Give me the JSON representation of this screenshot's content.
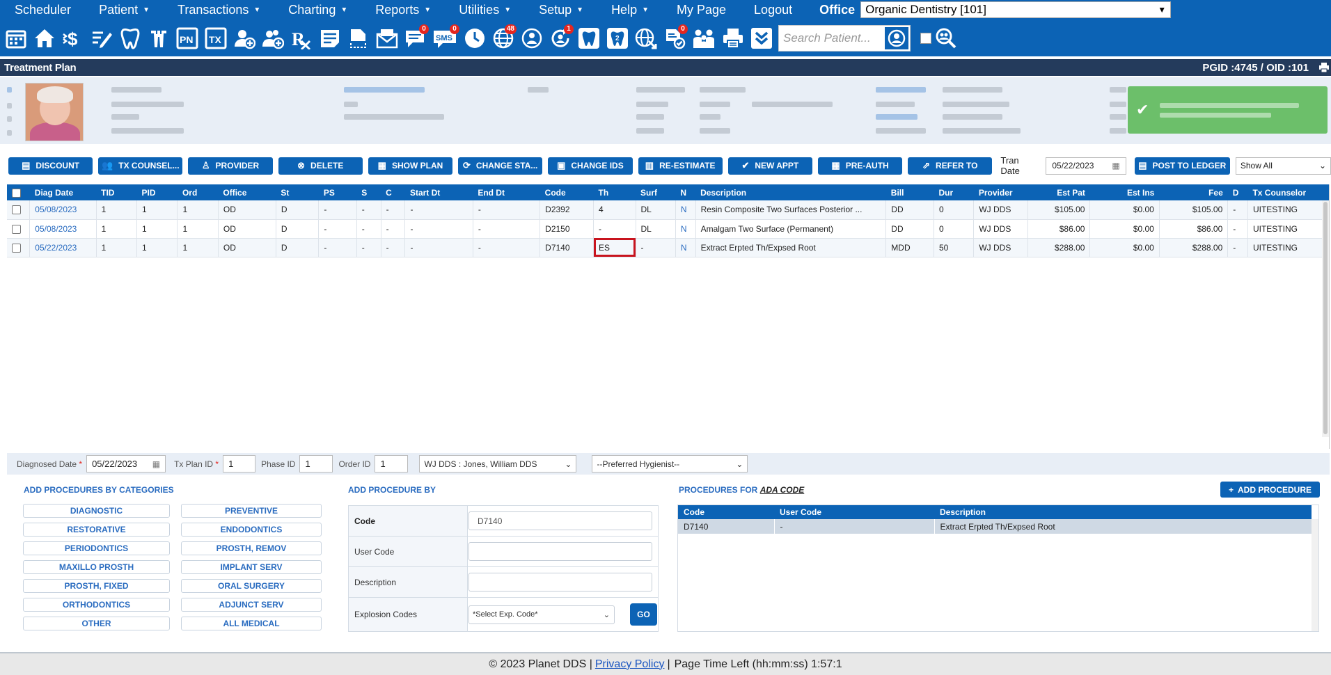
{
  "menu": {
    "items": [
      {
        "label": "Scheduler",
        "caret": false
      },
      {
        "label": "Patient",
        "caret": true
      },
      {
        "label": "Transactions",
        "caret": true
      },
      {
        "label": "Charting",
        "caret": true
      },
      {
        "label": "Reports",
        "caret": true
      },
      {
        "label": "Utilities",
        "caret": true
      },
      {
        "label": "Setup",
        "caret": true
      },
      {
        "label": "Help",
        "caret": true
      },
      {
        "label": "My Page",
        "caret": false
      },
      {
        "label": "Logout",
        "caret": false
      }
    ],
    "office_label": "Office",
    "office_value": "Organic Dentistry [101]"
  },
  "toolbar": {
    "badges": {
      "messages": "0",
      "sms": "0",
      "web": "48",
      "recall": "1",
      "docs": "0"
    },
    "sms_label": "SMS",
    "pn_label": "PN",
    "tx_label": "TX",
    "search_placeholder": "Search Patient..."
  },
  "titlebar": {
    "title": "Treatment Plan",
    "ids": "PGID :4745  /  OID :101"
  },
  "actions": {
    "buttons": [
      {
        "label": "DISCOUNT",
        "icon": "doc-icon"
      },
      {
        "label": "TX COUNSEL...",
        "icon": "people-icon"
      },
      {
        "label": "PROVIDER",
        "icon": "user-icon"
      },
      {
        "label": "DELETE",
        "icon": "close-circle-icon"
      },
      {
        "label": "SHOW PLAN",
        "icon": "calendar-icon"
      },
      {
        "label": "CHANGE STA...",
        "icon": "refresh-icon"
      },
      {
        "label": "CHANGE IDS",
        "icon": "id-card-icon"
      },
      {
        "label": "RE-ESTIMATE",
        "icon": "calculator-icon"
      },
      {
        "label": "NEW APPT",
        "icon": "check-circle-icon"
      },
      {
        "label": "PRE-AUTH",
        "icon": "calendar-check-icon"
      },
      {
        "label": "REFER TO",
        "icon": "refer-icon"
      }
    ],
    "tran_date_label": "Tran Date",
    "tran_date": "05/22/2023",
    "post_label": "POST TO LEDGER",
    "show_all": "Show All"
  },
  "table": {
    "headers": [
      "Diag Date",
      "TID",
      "PID",
      "Ord",
      "Office",
      "St",
      "PS",
      "S",
      "C",
      "Start Dt",
      "End Dt",
      "Code",
      "Th",
      "Surf",
      "N",
      "Description",
      "Bill",
      "Dur",
      "Provider",
      "Est Pat",
      "Est Ins",
      "Fee",
      "D",
      "Tx Counselor"
    ],
    "rows": [
      [
        "05/08/2023",
        "1",
        "1",
        "1",
        "OD",
        "D",
        "-",
        "-",
        "-",
        "-",
        "-",
        "D2392",
        "4",
        "DL",
        "N",
        "Resin Composite Two Surfaces Posterior ...",
        "DD",
        "0",
        "WJ DDS",
        "$105.00",
        "$0.00",
        "$105.00",
        "-",
        "UITESTING"
      ],
      [
        "05/08/2023",
        "1",
        "1",
        "1",
        "OD",
        "D",
        "-",
        "-",
        "-",
        "-",
        "-",
        "D2150",
        "-",
        "DL",
        "N",
        "Amalgam Two Surface (Permanent)",
        "DD",
        "0",
        "WJ DDS",
        "$86.00",
        "$0.00",
        "$86.00",
        "-",
        "UITESTING"
      ],
      [
        "05/22/2023",
        "1",
        "1",
        "1",
        "OD",
        "D",
        "-",
        "-",
        "-",
        "-",
        "-",
        "D7140",
        "ES",
        "-",
        "N",
        "Extract Erpted Th/Expsed Root",
        "MDD",
        "50",
        "WJ DDS",
        "$288.00",
        "$0.00",
        "$288.00",
        "-",
        "UITESTING"
      ]
    ]
  },
  "form": {
    "diag_label": "Diagnosed Date",
    "diag_date": "05/22/2023",
    "txplan_label": "Tx Plan ID",
    "txplan_id": "1",
    "phase_label": "Phase ID",
    "phase_id": "1",
    "order_label": "Order ID",
    "order_id": "1",
    "provider": "WJ DDS : Jones, William DDS",
    "hygienist": "--Preferred Hygienist--"
  },
  "categories": {
    "title": "ADD PROCEDURES BY CATEGORIES",
    "items": [
      "DIAGNOSTIC",
      "PREVENTIVE",
      "RESTORATIVE",
      "ENDODONTICS",
      "PERIODONTICS",
      "PROSTH, REMOV",
      "MAXILLO PROSTH",
      "IMPLANT SERV",
      "PROSTH, FIXED",
      "ORAL SURGERY",
      "ORTHODONTICS",
      "ADJUNCT SERV",
      "OTHER",
      "ALL MEDICAL"
    ]
  },
  "addby": {
    "title": "ADD PROCEDURE BY",
    "code_label": "Code",
    "code_value": "D7140",
    "usercode_label": "User Code",
    "desc_label": "Description",
    "explosion_label": "Explosion Codes",
    "explosion_value": "*Select Exp. Code*",
    "go_label": "GO"
  },
  "procedures": {
    "title": "PROCEDURES FOR",
    "title_link": "ADA CODE",
    "add_label": "ADD PROCEDURE",
    "headers": [
      "Code",
      "User Code",
      "Description"
    ],
    "rows": [
      [
        "D7140",
        "-",
        "Extract Erpted Th/Expsed Root"
      ]
    ]
  },
  "footer": {
    "copyright": "© 2023 Planet DDS |",
    "privacy": "Privacy Policy",
    "sep": "|",
    "time_left": "Page Time Left (hh:mm:ss) 1:57:1"
  }
}
